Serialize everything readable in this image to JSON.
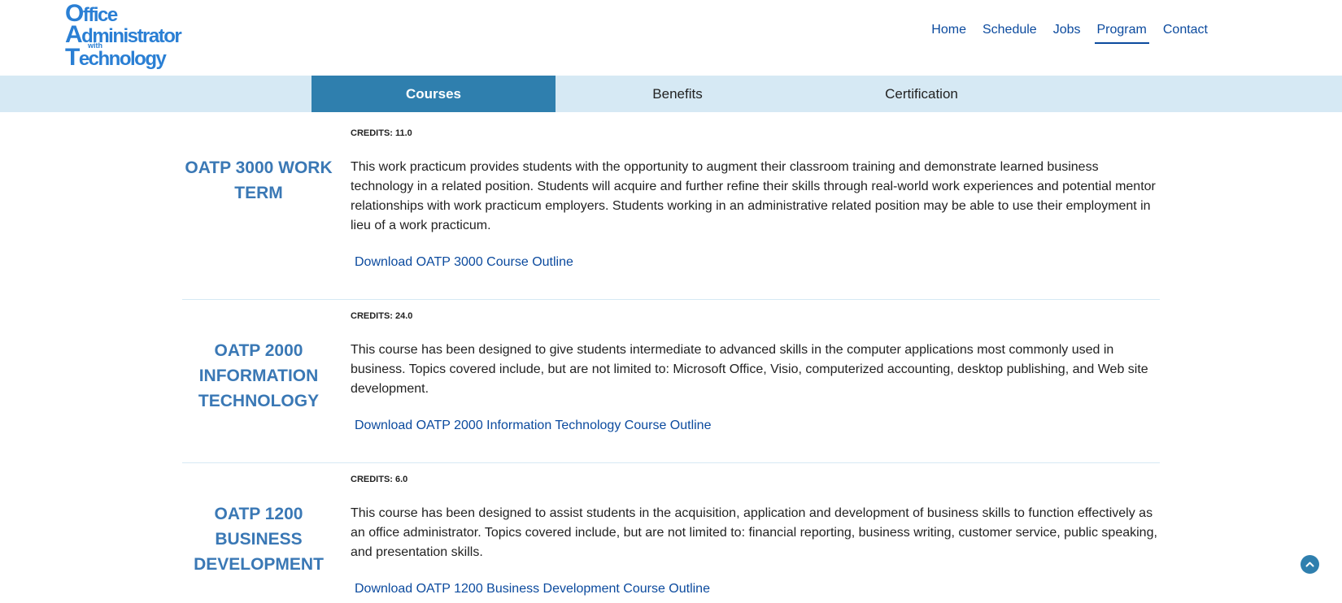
{
  "logo": {
    "line1_initial": "O",
    "line1_rest": "ffice",
    "line2_initial": "A",
    "line2_rest": "dministrator",
    "line3": "with",
    "line4_initial": "T",
    "line4_rest": "echnology"
  },
  "nav": {
    "items": [
      {
        "label": "Home"
      },
      {
        "label": "Schedule"
      },
      {
        "label": "Jobs"
      },
      {
        "label": "Program",
        "active": true
      },
      {
        "label": "Contact"
      }
    ]
  },
  "tabs": [
    {
      "label": "Courses",
      "active": true
    },
    {
      "label": "Benefits"
    },
    {
      "label": "Certification"
    }
  ],
  "courses": [
    {
      "title": "OATP 3000 WORK TERM",
      "credits": "CREDITS: 11.0",
      "description": "This work practicum provides students with the opportunity to augment their classroom training and demonstrate learned business technology in a related position. Students will acquire and further refine their skills through real-world work experiences and potential mentor relationships with work practicum employers. Students working in an administrative related position may be able to use their employment in lieu of a work practicum.",
      "download": "Download OATP 3000 Course Outline"
    },
    {
      "title": "OATP 2000 INFORMATION TECHNOLOGY",
      "credits": "CREDITS: 24.0",
      "description": "This course has been designed to give students intermediate to advanced skills in the computer applications most commonly used in business. Topics covered include, but are not limited to: Microsoft Office, Visio, computerized accounting, desktop publishing, and Web site development.",
      "download": "Download OATP 2000 Information Technology Course Outline"
    },
    {
      "title": "OATP 1200 BUSINESS DEVELOPMENT",
      "credits": "CREDITS: 6.0",
      "description": "This course has been designed to assist students in the acquisition, application and development of business skills to function effectively as an office administrator. Topics covered include, but are not limited to: financial reporting, business writing, customer service, public speaking, and presentation skills.",
      "download": "Download OATP 1200 Business Development Course Outline"
    }
  ],
  "icons": {
    "scroll_top": "chevron-up-icon"
  },
  "colors": {
    "accent": "#2f7fae",
    "link": "#0b4a9e",
    "title": "#3a78b5",
    "tabbar": "#d6e9f4",
    "logo": "#2a7fd4"
  }
}
